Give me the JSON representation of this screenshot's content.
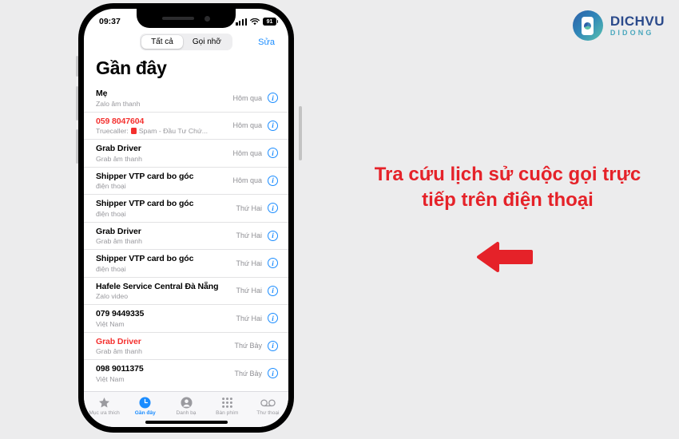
{
  "brand": {
    "name": "DICHVU",
    "sub": "DIDONG",
    "icon": "mobile-app-logo-icon",
    "accent": "#2b4a8b",
    "accent_sub": "#49a7bd"
  },
  "promo": {
    "headline_line1": "Tra cứu lịch sử cuộc gọi trực",
    "headline_line2": "tiếp trên điện thoại",
    "color": "#e52229",
    "arrow": "left-arrow-icon"
  },
  "phone": {
    "status_bar": {
      "time": "09:37",
      "signal_icon": "cellular-bars-icon",
      "wifi_icon": "wifi-icon",
      "battery_level": "91"
    },
    "segmented_control": {
      "options": [
        "Tất cả",
        "Gọi nhỡ"
      ],
      "selected": "Tất cả"
    },
    "edit_label": "Sửa",
    "title": "Gần đây",
    "info_icon": "info-circle-icon",
    "calls": [
      {
        "name": "Mẹ",
        "sub": "Zalo âm thanh",
        "time": "Hôm qua",
        "missed": false,
        "spam": false
      },
      {
        "name": "059 8047604",
        "sub": "Truecaller:",
        "spam_text": "Spam - Đầu Tư Chứ...",
        "time": "Hôm qua",
        "missed": true,
        "spam": true
      },
      {
        "name": "Grab Driver",
        "sub": "Grab âm thanh",
        "time": "Hôm qua",
        "missed": false,
        "spam": false
      },
      {
        "name": "Shipper VTP card bo góc",
        "sub": "điện thoại",
        "time": "Hôm qua",
        "missed": false,
        "spam": false
      },
      {
        "name": "Shipper VTP card bo góc",
        "sub": "điện thoại",
        "time": "Thứ Hai",
        "missed": false,
        "spam": false
      },
      {
        "name": "Grab Driver",
        "sub": "Grab âm thanh",
        "time": "Thứ Hai",
        "missed": false,
        "spam": false
      },
      {
        "name": "Shipper VTP card bo góc",
        "sub": "điện thoại",
        "time": "Thứ Hai",
        "missed": false,
        "spam": false
      },
      {
        "name": "Hafele Service Central Đà Nẵng",
        "sub": "Zalo video",
        "time": "Thứ Hai",
        "missed": false,
        "spam": false
      },
      {
        "name": "079 9449335",
        "sub": "Việt Nam",
        "time": "Thứ Hai",
        "missed": false,
        "spam": false
      },
      {
        "name": "Grab Driver",
        "sub": "Grab âm thanh",
        "time": "Thứ Bảy",
        "missed": true,
        "spam": false
      },
      {
        "name": "098 9011375",
        "sub": "Việt Nam",
        "time": "Thứ Bảy",
        "missed": false,
        "spam": false
      }
    ],
    "tabs": [
      {
        "label": "Mục ưa thích",
        "icon": "star-icon",
        "active": false
      },
      {
        "label": "Gần đây",
        "icon": "clock-icon",
        "active": true
      },
      {
        "label": "Danh bạ",
        "icon": "person-icon",
        "active": false
      },
      {
        "label": "Bàn phím",
        "icon": "keypad-icon",
        "active": false
      },
      {
        "label": "Thư thoại",
        "icon": "voicemail-icon",
        "active": false
      }
    ]
  }
}
